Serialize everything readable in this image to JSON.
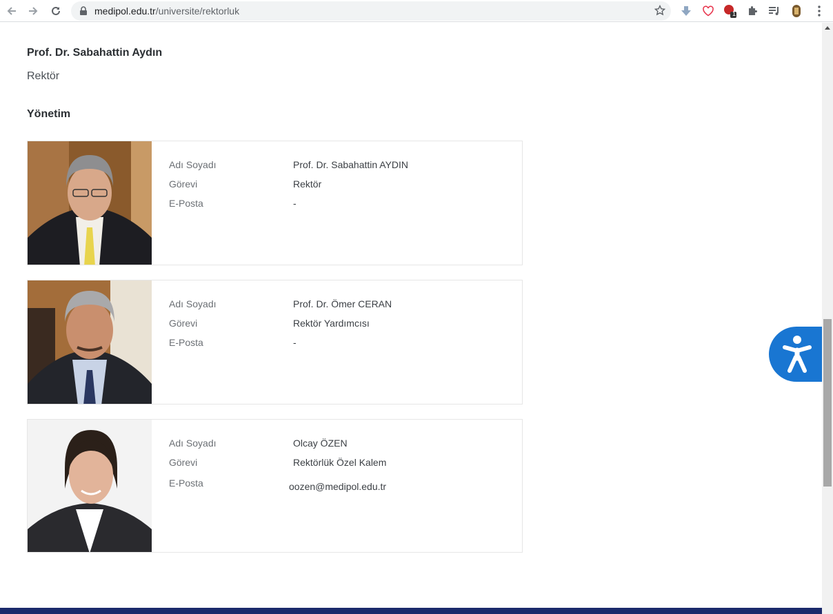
{
  "browser": {
    "url_host": "medipol.edu.tr",
    "url_path": "/universite/rektorluk",
    "extension_badge": "1"
  },
  "page": {
    "rector_name": "Prof. Dr. Sabahattin Aydın",
    "rector_title": "Rektör",
    "section_title": "Yönetim",
    "labels": {
      "name": "Adı Soyadı",
      "position": "Görevi",
      "email": "E-Posta"
    },
    "people": [
      {
        "name": "Prof. Dr. Sabahattin AYDIN",
        "position": "Rektör",
        "email": "-"
      },
      {
        "name": "Prof. Dr. Ömer CERAN",
        "position": "Rektör Yardımcısı",
        "email": "-"
      },
      {
        "name": "Olcay ÖZEN",
        "position": "Rektörlük Özel Kalem",
        "email": "oozen@medipol.edu.tr"
      }
    ]
  },
  "colors": {
    "accent": "#1976d2",
    "footer": "#1b2a6b"
  }
}
